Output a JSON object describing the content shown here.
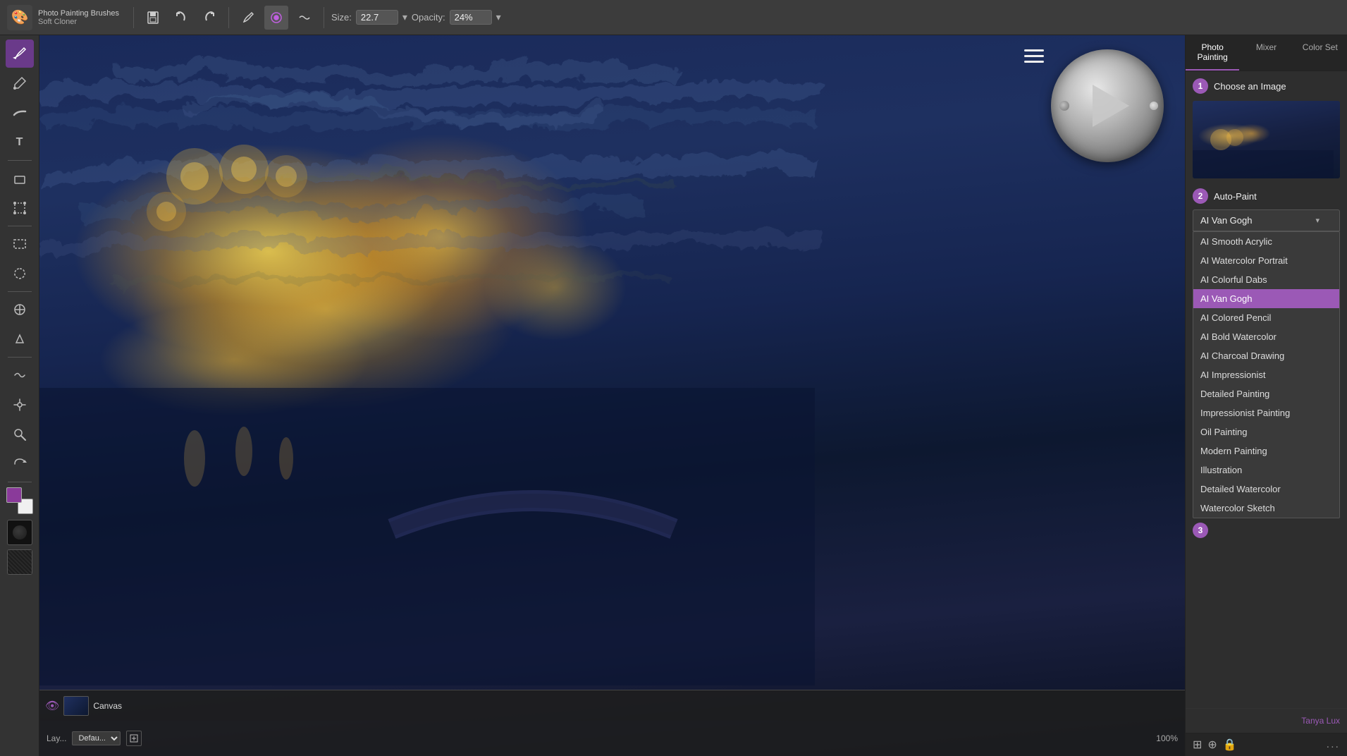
{
  "app": {
    "title": "Photo Painting Brushes",
    "subtitle": "Soft Cloner",
    "icon": "🎨"
  },
  "toolbar": {
    "save_label": "💾",
    "undo_label": "↩",
    "redo_label": "↪",
    "brush_label": "🖌",
    "opacity_brush": "◉",
    "liquid_label": "〜",
    "size_label": "Size:",
    "size_value": "22.7",
    "opacity_label": "Opacity:",
    "opacity_value": "24%"
  },
  "tools": [
    {
      "name": "brush",
      "icon": "/",
      "active": true
    },
    {
      "name": "dropper",
      "icon": "💧"
    },
    {
      "name": "smear",
      "icon": "〜"
    },
    {
      "name": "text",
      "icon": "T"
    },
    {
      "name": "eraser",
      "icon": "◻"
    },
    {
      "name": "transform",
      "icon": "⊕"
    },
    {
      "name": "selection-rect",
      "icon": "⬚"
    },
    {
      "name": "selection-lasso",
      "icon": "⌒"
    },
    {
      "name": "clone",
      "icon": "⊕"
    },
    {
      "name": "dodge",
      "icon": "◑"
    },
    {
      "name": "liquify",
      "icon": "〜"
    },
    {
      "name": "pan",
      "icon": "✋"
    },
    {
      "name": "zoom",
      "icon": "🔍"
    },
    {
      "name": "rotate",
      "icon": "↻"
    },
    {
      "name": "color-fg",
      "icon": "●"
    },
    {
      "name": "color-bg",
      "icon": "○"
    },
    {
      "name": "texture",
      "icon": "▦"
    }
  ],
  "right_panel": {
    "tabs": [
      {
        "id": "photo-painting",
        "label": "Photo Painting",
        "active": true
      },
      {
        "id": "mixer",
        "label": "Mixer"
      },
      {
        "id": "color-set",
        "label": "Color Set"
      }
    ],
    "step1": {
      "number": "1",
      "label": "Choose an Image"
    },
    "step2": {
      "number": "2",
      "label": "Auto-Paint"
    },
    "step3": {
      "number": "3",
      "label": ""
    },
    "dropdown_selected": "AI Van Gogh",
    "dropdown_items": [
      {
        "label": "AI Smooth Acrylic",
        "selected": false
      },
      {
        "label": "AI Watercolor Portrait",
        "selected": false
      },
      {
        "label": "AI Colorful Dabs",
        "selected": false
      },
      {
        "label": "AI Van Gogh",
        "selected": true,
        "highlighted": true
      },
      {
        "label": "AI Colored Pencil",
        "selected": false
      },
      {
        "label": "AI Bold Watercolor",
        "selected": false
      },
      {
        "label": "AI Charcoal Drawing",
        "selected": false
      },
      {
        "label": "AI Impressionist",
        "selected": false
      },
      {
        "label": "Detailed Painting",
        "selected": false
      },
      {
        "label": "Impressionist Painting",
        "selected": false
      },
      {
        "label": "Oil Painting",
        "selected": false
      },
      {
        "label": "Modern Painting",
        "selected": false
      },
      {
        "label": "Illustration",
        "selected": false
      },
      {
        "label": "Detailed Watercolor",
        "selected": false
      },
      {
        "label": "Watercolor Sketch",
        "selected": false
      }
    ]
  },
  "layers": {
    "title": "Layers",
    "default_label": "Default",
    "opacity_label": "100%",
    "items": [
      {
        "name": "Canvas",
        "visible": true
      }
    ]
  },
  "statusbar": {
    "user": "Tanya Lux",
    "dots": "..."
  },
  "canvas": {
    "menu_icon": "≡"
  }
}
